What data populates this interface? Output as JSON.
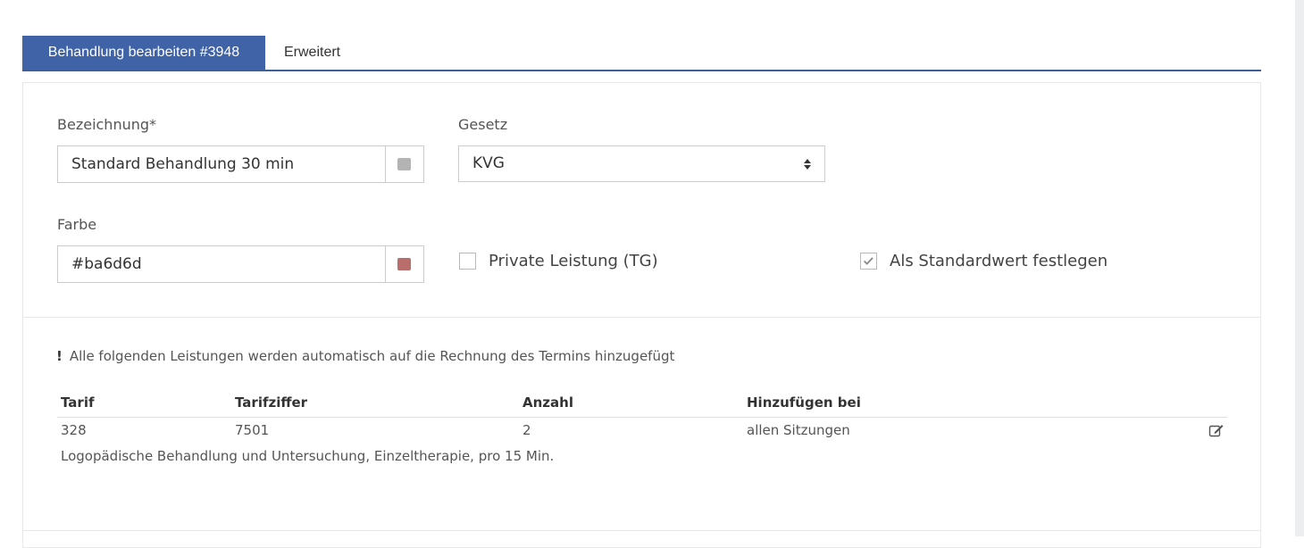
{
  "tabs": [
    {
      "label": "Behandlung bearbeiten #3948",
      "active": true
    },
    {
      "label": "Erweitert",
      "active": false
    }
  ],
  "form": {
    "bezeichnung_label": "Bezeichnung*",
    "bezeichnung_value": "Standard Behandlung 30 min",
    "gesetz_label": "Gesetz",
    "gesetz_value": "KVG",
    "farbe_label": "Farbe",
    "farbe_value": "#ba6d6d",
    "private_label": "Private Leistung (TG)",
    "private_checked": false,
    "standard_label": "Als Standardwert festlegen",
    "standard_checked": true
  },
  "colors": {
    "accent": "#3f63a6",
    "bezeichnung_swatch": "#b3b3b3",
    "farbe_swatch": "#ba6d6d"
  },
  "notice": {
    "mark": "!",
    "text": "Alle folgenden Leistungen werden automatisch auf die Rechnung des Termins hinzugefügt"
  },
  "table": {
    "headers": [
      "Tarif",
      "Tarifziffer",
      "Anzahl",
      "Hinzufügen bei"
    ],
    "rows": [
      {
        "tarif": "328",
        "tarifziffer": "7501",
        "anzahl": "2",
        "hinzufuegen": "allen Sitzungen",
        "description": "Logopädische Behandlung und Untersuchung, Einzeltherapie, pro 15 Min."
      }
    ]
  },
  "icons": {
    "edit": "edit-icon",
    "select_arrows": "sort-arrows-icon",
    "check": "checkmark-icon"
  }
}
